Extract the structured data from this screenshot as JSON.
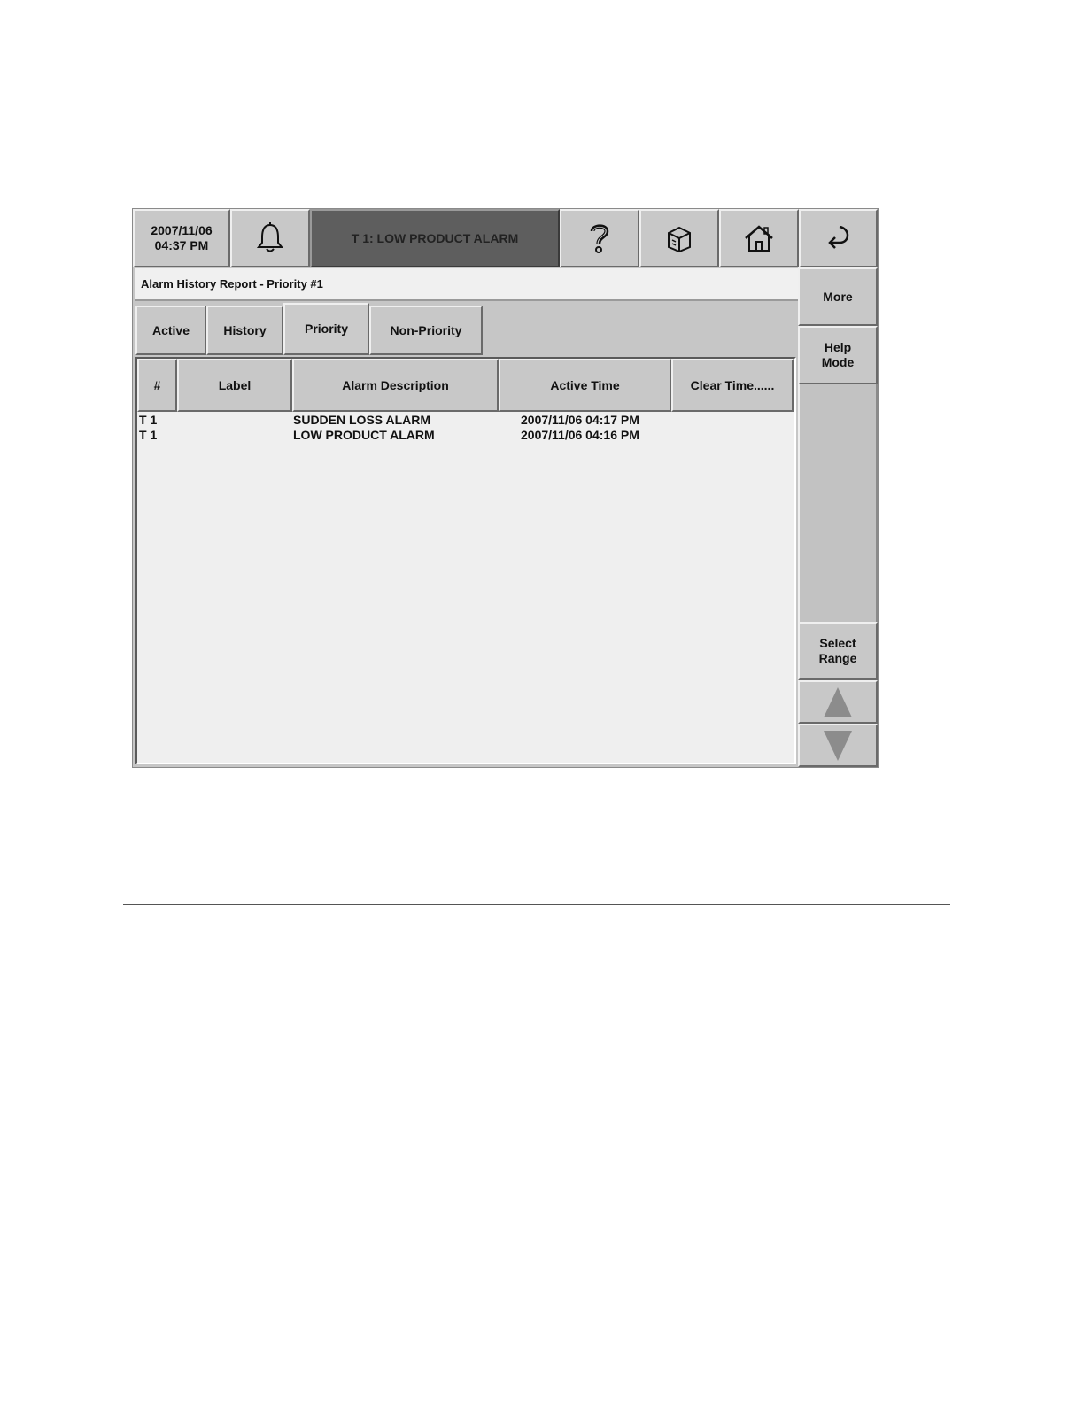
{
  "header": {
    "date": "2007/11/06",
    "time": "04:37 PM",
    "alarm_banner": "T 1: LOW PRODUCT ALARM",
    "icons": [
      "bell-icon",
      "help-icon",
      "box-icon",
      "home-icon",
      "return-icon"
    ]
  },
  "report_title": "Alarm History Report - Priority #1",
  "tabs": [
    {
      "label": "Active"
    },
    {
      "label": "History"
    },
    {
      "label": "Priority",
      "selected": true
    },
    {
      "label": "Non-Priority"
    }
  ],
  "table": {
    "columns": [
      "#",
      "Label",
      "Alarm Description",
      "Active Time",
      "Clear Time......"
    ],
    "rows": [
      {
        "num": "T 1",
        "label": "",
        "description": "SUDDEN LOSS ALARM",
        "active_time": "2007/11/06 04:17 PM",
        "clear_time": ""
      },
      {
        "num": "T 1",
        "label": "",
        "description": "LOW PRODUCT ALARM",
        "active_time": "2007/11/06 04:16 PM",
        "clear_time": ""
      }
    ]
  },
  "side_buttons": {
    "more": "More",
    "help_mode_line1": "Help",
    "help_mode_line2": "Mode",
    "select_range_line1": "Select",
    "select_range_line2": "Range"
  }
}
